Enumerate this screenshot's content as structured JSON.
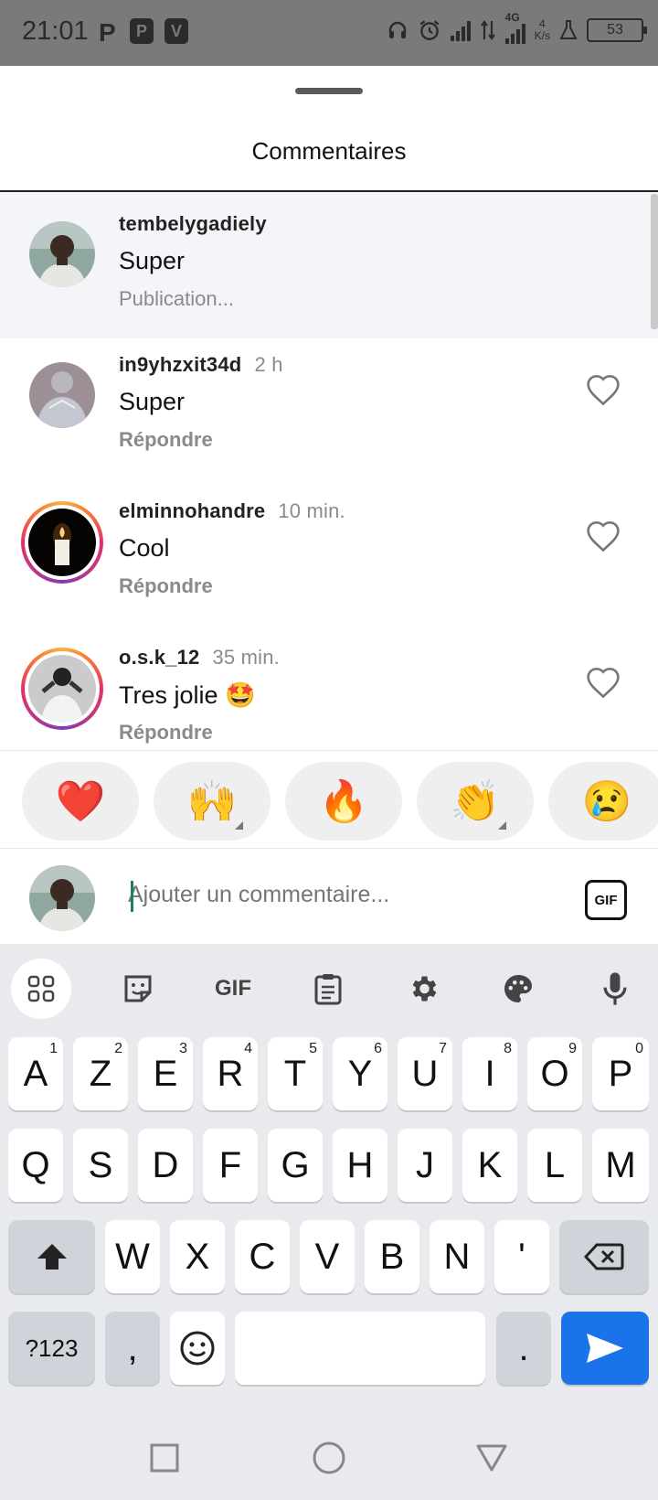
{
  "status_bar": {
    "time": "21:01",
    "left_icons": [
      "parking-icon",
      "parking-ticket-icon",
      "v-app-icon"
    ],
    "network_4g": "4G",
    "speed_value": "4",
    "speed_unit": "K/s",
    "battery": "53"
  },
  "sheet": {
    "title": "Commentaires"
  },
  "comments": [
    {
      "username": "tembelygadiely",
      "time": "",
      "text": "Super",
      "action": "Publication...",
      "pinned": true,
      "has_story_ring": false,
      "avatar": "man-avatar"
    },
    {
      "username": "in9yhzxit34d",
      "time": "2 h",
      "text": "Super",
      "action": "Répondre",
      "pinned": false,
      "has_story_ring": false,
      "avatar": "person-gray-avatar"
    },
    {
      "username": "elminnohandre",
      "time": "10 min.",
      "text": "Cool",
      "action": "Répondre",
      "pinned": false,
      "has_story_ring": true,
      "avatar": "candle-avatar"
    },
    {
      "username": "o.s.k_12",
      "time": "35 min.",
      "text": "Tres jolie 🤩",
      "action": "Répondre",
      "pinned": false,
      "has_story_ring": true,
      "avatar": "bw-photo-avatar"
    }
  ],
  "reactions": [
    "❤️",
    "🙌",
    "🔥",
    "👏",
    "😢"
  ],
  "composer": {
    "placeholder": "Ajouter un commentaire...",
    "gif_label": "GIF"
  },
  "keyboard": {
    "toolbar_gif": "GIF",
    "row1": [
      {
        "key": "A",
        "hint": "1"
      },
      {
        "key": "Z",
        "hint": "2"
      },
      {
        "key": "E",
        "hint": "3"
      },
      {
        "key": "R",
        "hint": "4"
      },
      {
        "key": "T",
        "hint": "5"
      },
      {
        "key": "Y",
        "hint": "6"
      },
      {
        "key": "U",
        "hint": "7"
      },
      {
        "key": "I",
        "hint": "8"
      },
      {
        "key": "O",
        "hint": "9"
      },
      {
        "key": "P",
        "hint": "0"
      }
    ],
    "row2": [
      "Q",
      "S",
      "D",
      "F",
      "G",
      "H",
      "J",
      "K",
      "L",
      "M"
    ],
    "row3": [
      "W",
      "X",
      "C",
      "V",
      "B",
      "N",
      "'"
    ],
    "symbols_key": "?123",
    "comma_key": ",",
    "period_key": "."
  },
  "colors": {
    "accent": "#1a73e8",
    "status_bar": "#7a7a7a",
    "pinned_bg": "#f3f5f9",
    "keyboard_bg": "#e8eaee"
  }
}
